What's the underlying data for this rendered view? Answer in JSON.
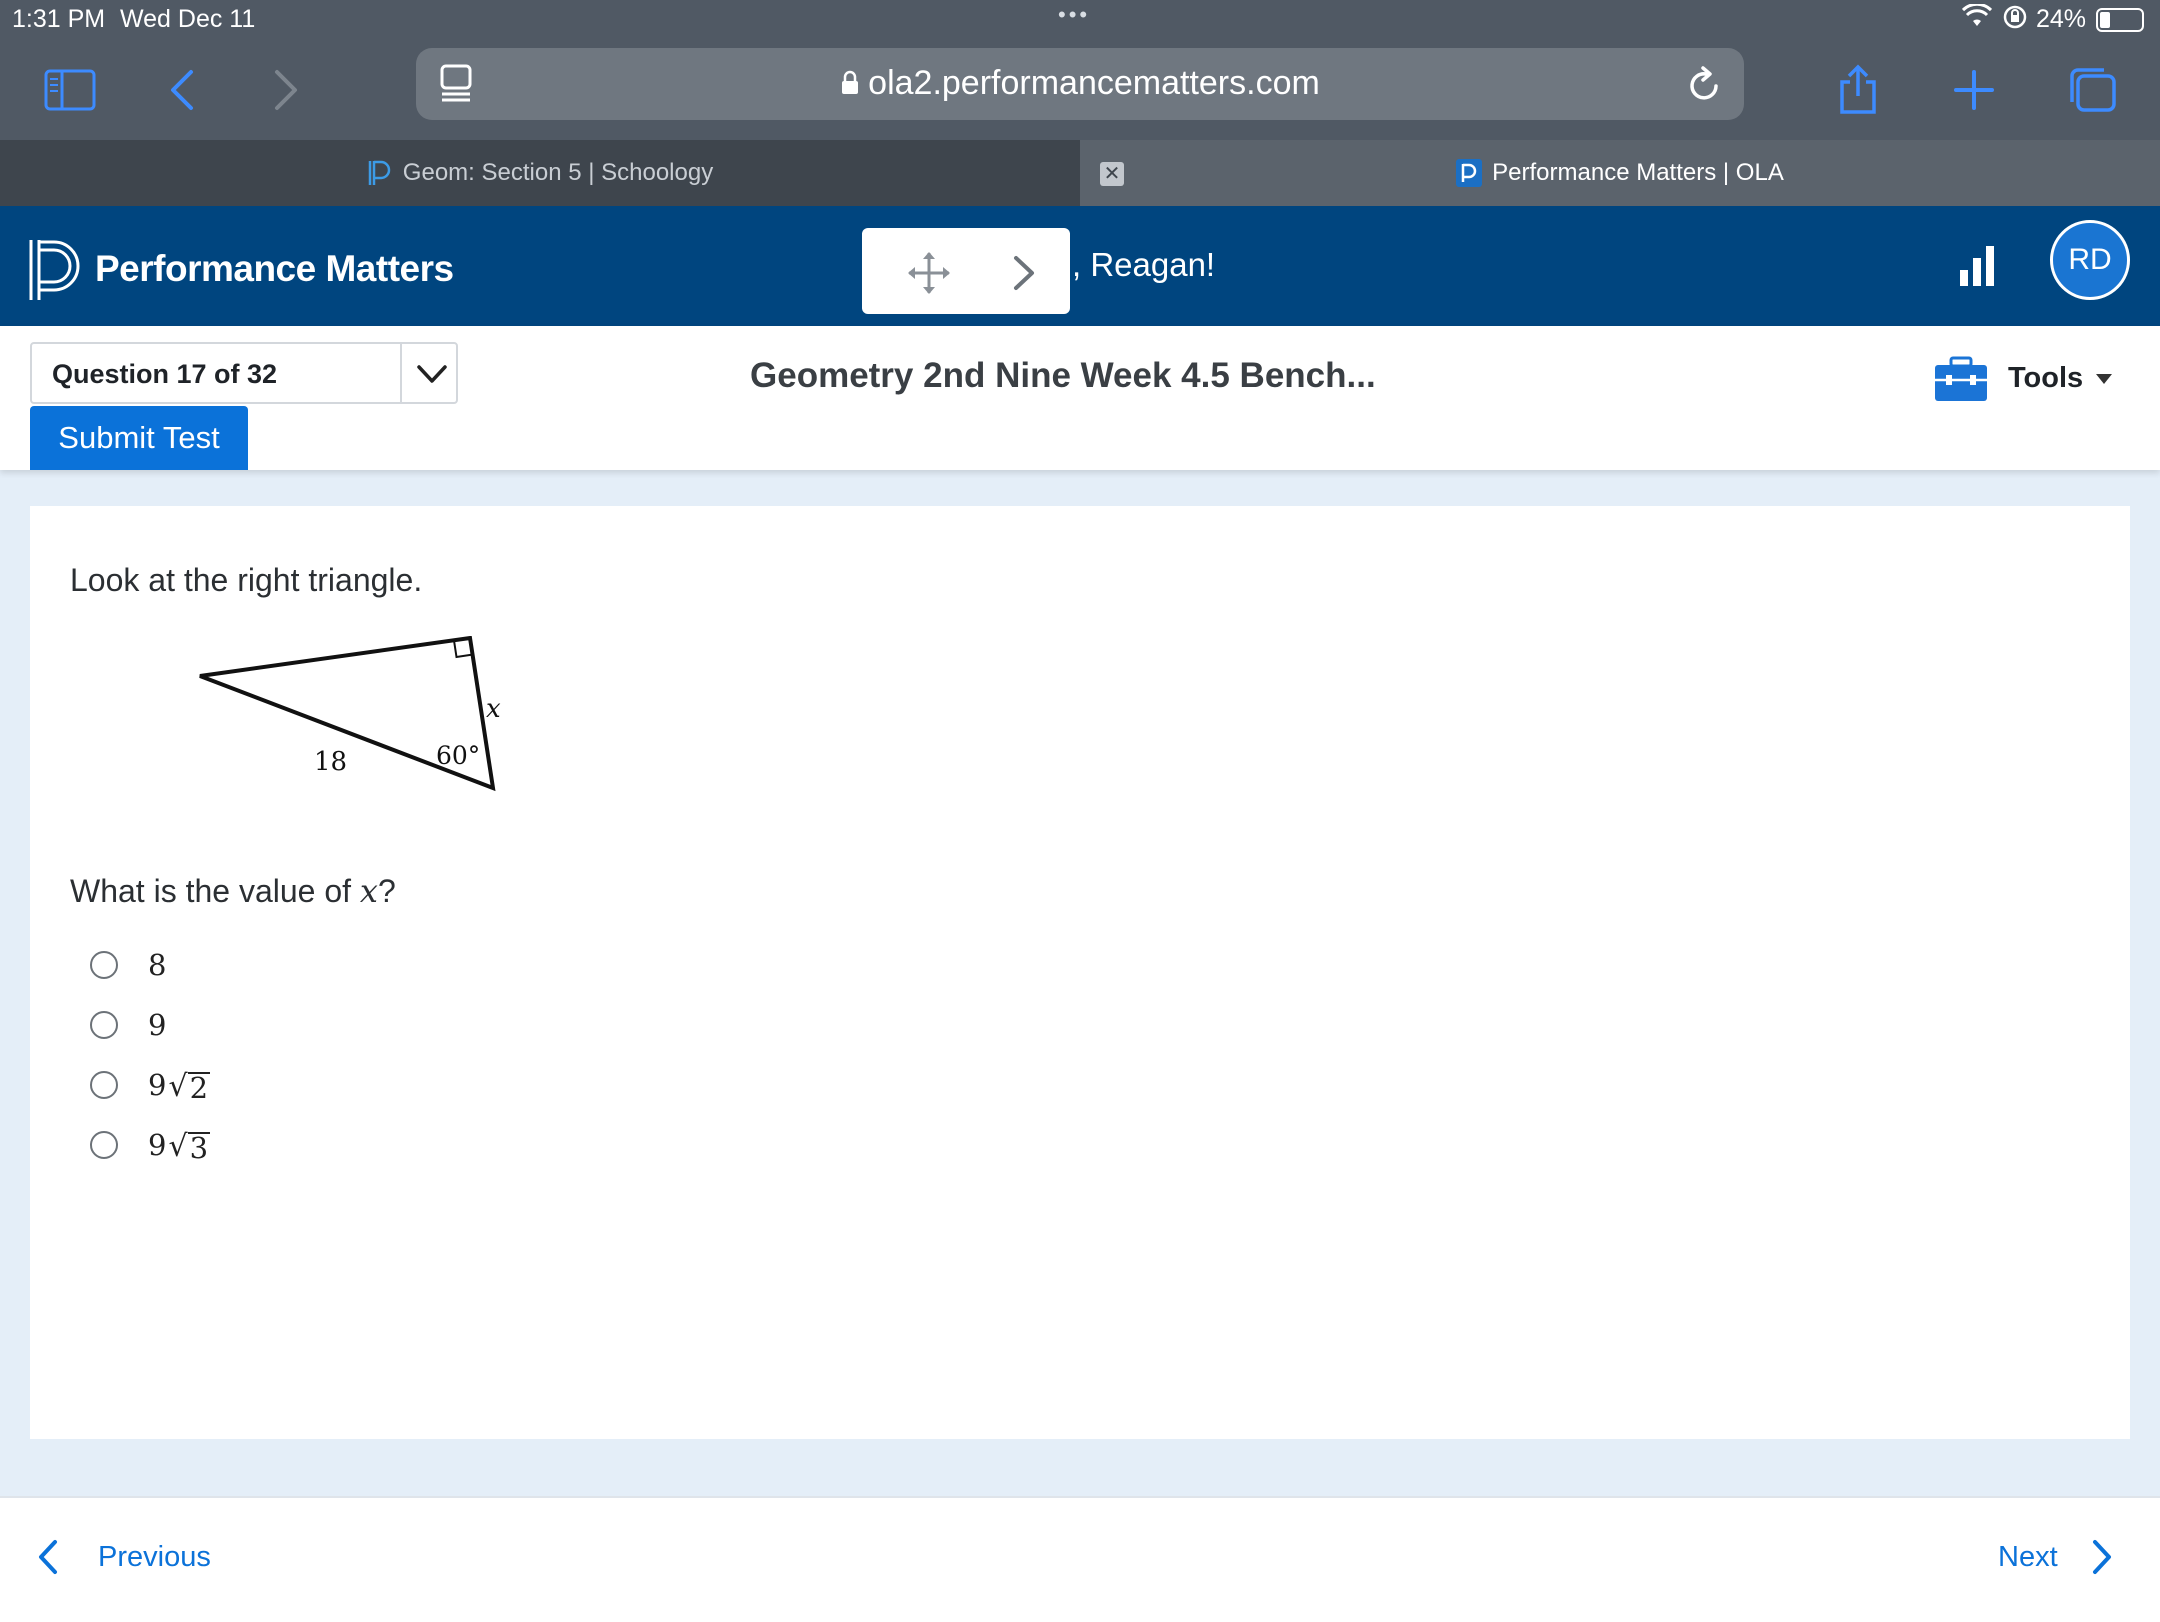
{
  "status_bar": {
    "time": "1:31 PM",
    "date": "Wed Dec 11",
    "battery": "24%",
    "battery_level_fraction": 0.24
  },
  "browser": {
    "url": "ola2.performancematters.com",
    "tabs": [
      {
        "label": "Geom: Section 5 | Schoology",
        "active": false
      },
      {
        "label": "Performance Matters | OLA",
        "active": true
      }
    ],
    "icons": [
      "sidebar-icon",
      "back-icon",
      "forward-icon",
      "reader-icon",
      "lock-icon",
      "reload-icon",
      "share-icon",
      "new-tab-icon",
      "tabs-overview-icon"
    ]
  },
  "app": {
    "brand": "Performance Matters",
    "greeting": ", Reagan!",
    "avatar_initials": "RD",
    "colors": {
      "header": "#00457f",
      "accent": "#0b72d9"
    }
  },
  "question_bar": {
    "question_selector": "Question 17 of 32",
    "submit_label": "Submit Test",
    "test_title": "Geometry 2nd Nine Week 4.5 Bench...",
    "tools_label": "Tools"
  },
  "question": {
    "prompt": "Look at the right triangle.",
    "figure": {
      "side_label": "18",
      "angle_label": "60°",
      "unknown_label": "x"
    },
    "stem_prefix": "What is the value of ",
    "stem_var": "x",
    "stem_suffix": "?",
    "options": [
      {
        "coef": "8",
        "radicand": ""
      },
      {
        "coef": "9",
        "radicand": ""
      },
      {
        "coef": "9",
        "radicand": "2"
      },
      {
        "coef": "9",
        "radicand": "3"
      }
    ]
  },
  "footer": {
    "previous_label": "Previous",
    "next_label": "Next"
  }
}
